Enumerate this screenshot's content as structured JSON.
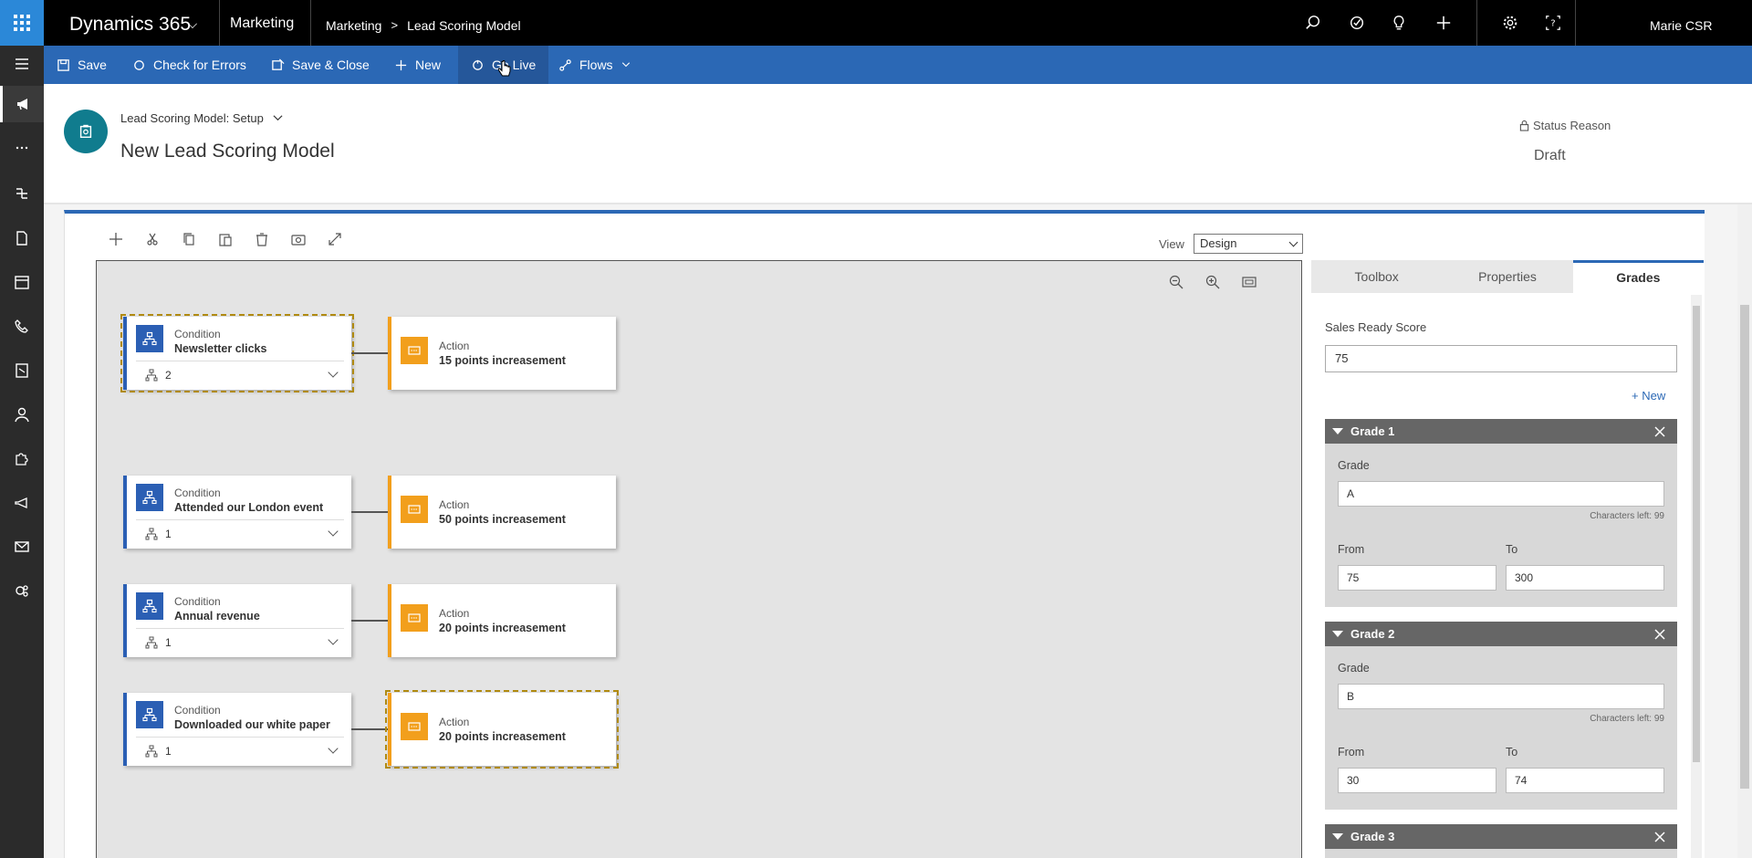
{
  "topbar": {
    "app_name": "Dynamics 365",
    "area": "Marketing",
    "breadcrumb": [
      "Marketing",
      "Lead Scoring Model"
    ],
    "breadcrumb_separator": ">",
    "user": "Marie CSR",
    "icons": [
      "search-icon",
      "task-icon",
      "lightbulb-icon",
      "plus-icon",
      "gear-icon",
      "help-icon"
    ]
  },
  "commands": {
    "save": "Save",
    "check_errors": "Check for Errors",
    "save_close": "Save & Close",
    "new": "New",
    "go_live": "Go Live",
    "flows": "Flows"
  },
  "header": {
    "form_selector": "Lead Scoring Model: Setup",
    "title": "New Lead Scoring Model",
    "status_label": "Status Reason",
    "status_value": "Draft"
  },
  "designer": {
    "view_label": "View",
    "view_value": "Design",
    "rules": [
      {
        "condition_type": "Condition",
        "condition_name": "Newsletter clicks",
        "branches": "2",
        "action_type": "Action",
        "action_name": "15 points increasement"
      },
      {
        "condition_type": "Condition",
        "condition_name": "Attended our London event",
        "branches": "1",
        "action_type": "Action",
        "action_name": "50 points increasement"
      },
      {
        "condition_type": "Condition",
        "condition_name": "Annual revenue",
        "branches": "1",
        "action_type": "Action",
        "action_name": "20 points increasement"
      },
      {
        "condition_type": "Condition",
        "condition_name": "Downloaded our white paper",
        "branches": "1",
        "action_type": "Action",
        "action_name": "20 points increasement"
      }
    ]
  },
  "pane": {
    "tabs": [
      "Toolbox",
      "Properties",
      "Grades"
    ],
    "active_tab": "Grades",
    "sales_ready_label": "Sales Ready Score",
    "sales_ready_value": "75",
    "new_link": "+ New",
    "grades": [
      {
        "title": "Grade 1",
        "grade_label": "Grade",
        "grade_value": "A",
        "chars_left": "Characters left: 99",
        "from_label": "From",
        "from_value": "75",
        "to_label": "To",
        "to_value": "300"
      },
      {
        "title": "Grade 2",
        "grade_label": "Grade",
        "grade_value": "B",
        "chars_left": "Characters left: 99",
        "from_label": "From",
        "from_value": "30",
        "to_label": "To",
        "to_value": "74"
      },
      {
        "title": "Grade 3"
      }
    ]
  },
  "colors": {
    "nav_black": "#000000",
    "command_blue": "#2b68b5",
    "condition_blue": "#2b5fb4",
    "action_orange": "#f29f1c",
    "entity_teal": "#107c8e"
  }
}
